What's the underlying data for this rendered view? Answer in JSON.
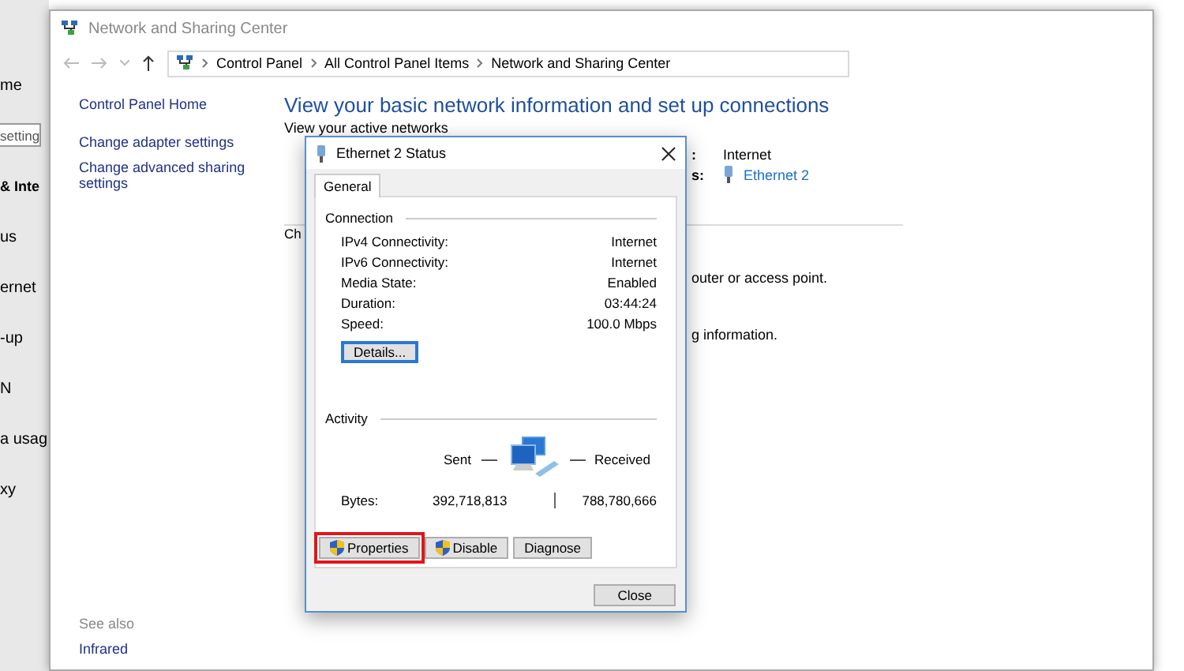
{
  "settings_panel": {
    "items": [
      {
        "label": "me",
        "kind": "item"
      },
      {
        "label": "setting",
        "kind": "search"
      },
      {
        "label": "& Inte",
        "kind": "heading"
      },
      {
        "label": "us",
        "kind": "item"
      },
      {
        "label": "ernet",
        "kind": "item"
      },
      {
        "label": "-up",
        "kind": "item"
      },
      {
        "label": "N",
        "kind": "item"
      },
      {
        "label": "a usag",
        "kind": "item"
      },
      {
        "label": "xy",
        "kind": "item"
      }
    ]
  },
  "window": {
    "title": "Network and Sharing Center",
    "breadcrumbs": [
      "Control Panel",
      "All Control Panel Items",
      "Network and Sharing Center"
    ],
    "sidebar": {
      "links": [
        "Control Panel Home",
        "Change adapter settings",
        "Change advanced sharing settings"
      ],
      "see_also": "See also",
      "see_also_links": [
        "Infrared"
      ]
    },
    "heading": "View your basic network information and set up connections",
    "active_networks_label": "View your active networks",
    "access_type": {
      "label_fragment": ":",
      "value": "Internet"
    },
    "connections": {
      "label_fragment": "s:",
      "value": "Ethernet 2"
    },
    "change_settings_fragment": "Ch",
    "text_fragments": [
      "outer or access point.",
      "g information."
    ]
  },
  "dialog": {
    "title": "Ethernet 2 Status",
    "tabs": [
      {
        "label": "General",
        "selected": true
      }
    ],
    "connection": {
      "title": "Connection",
      "rows": [
        {
          "label": "IPv4 Connectivity:",
          "value": "Internet"
        },
        {
          "label": "IPv6 Connectivity:",
          "value": "Internet"
        },
        {
          "label": "Media State:",
          "value": "Enabled"
        },
        {
          "label": "Duration:",
          "value": "03:44:24"
        },
        {
          "label": "Speed:",
          "value": "100.0 Mbps"
        }
      ],
      "details_button": "Details..."
    },
    "activity": {
      "title": "Activity",
      "sent": "Sent",
      "received": "Received",
      "bytes_label": "Bytes:",
      "bytes_sent": "392,718,813",
      "bytes_received": "788,780,666"
    },
    "buttons": [
      {
        "label": "Properties",
        "shield": true,
        "highlighted": true
      },
      {
        "label": "Disable",
        "shield": true,
        "highlighted": false
      },
      {
        "label": "Diagnose",
        "shield": false,
        "highlighted": false
      }
    ],
    "close_button": "Close"
  }
}
